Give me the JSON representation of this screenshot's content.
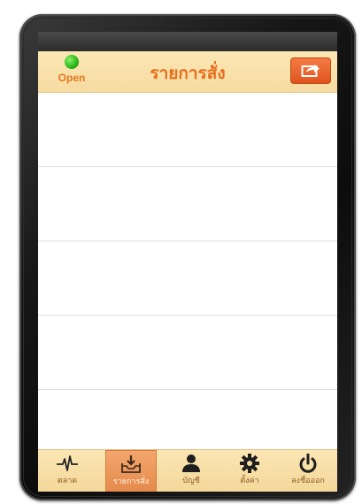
{
  "header": {
    "open_label": "Open",
    "title": "รายการสั่ง",
    "share_icon": "share-icon"
  },
  "list": {
    "rows": [
      "",
      "",
      "",
      "",
      ""
    ]
  },
  "tabbar": {
    "items": [
      {
        "label": "ตลาด",
        "icon": "pulse-icon"
      },
      {
        "label": "รายการสั่ง",
        "icon": "inbox-download-icon",
        "active": true
      },
      {
        "label": "บัญชี",
        "icon": "person-icon"
      },
      {
        "label": "ตั้งค่า",
        "icon": "gear-icon"
      },
      {
        "label": "ลงชื่อออก",
        "icon": "power-icon"
      }
    ]
  },
  "colors": {
    "header_bg": "#f8e0a8",
    "title": "#e66d1d",
    "share_button": "#e8602a",
    "open_dot": "#2dbb1c",
    "tab_active": "#e9935a"
  }
}
